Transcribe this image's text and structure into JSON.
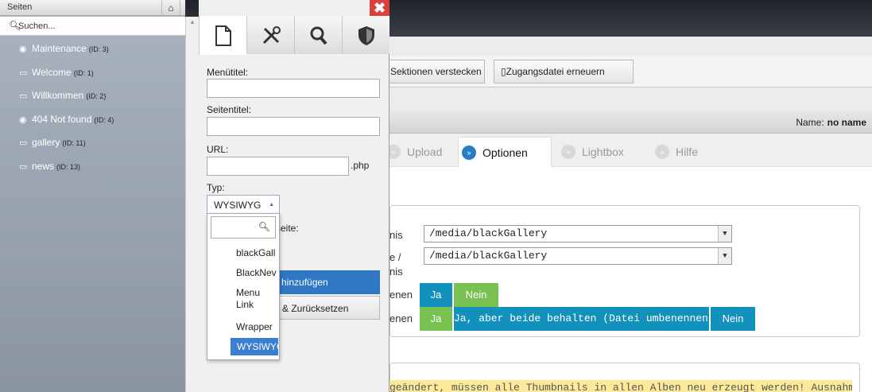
{
  "sidebar": {
    "title": "Seiten",
    "search_placeholder": "Suchen...",
    "pages": [
      {
        "name": "Maintenance",
        "id": "(ID: 3)",
        "icon": "eye-icon"
      },
      {
        "name": "Welcome",
        "id": "(ID: 1)",
        "icon": "monitor-icon"
      },
      {
        "name": "Willkommen",
        "id": "(ID: 2)",
        "icon": "monitor-icon"
      },
      {
        "name": "404 Not found",
        "id": "(ID: 4)",
        "icon": "eye-icon"
      },
      {
        "name": "gallery",
        "id": "(ID: 11)",
        "icon": "monitor-icon"
      },
      {
        "name": "news",
        "id": "(ID: 13)",
        "icon": "monitor-icon"
      }
    ]
  },
  "panel": {
    "tabs": [
      "page-icon",
      "tools-icon",
      "search-icon",
      "shield-icon"
    ],
    "menutitel_label": "Menütitel:",
    "seitentitel_label": "Seitentitel:",
    "url_label": "URL:",
    "url_suffix": ".php",
    "typ_label": "Typ:",
    "typ_value": "WYSIWYG",
    "startseite_label": "seite:",
    "add_button": "e hinzufügen",
    "reset_button": "o & Zurücksetzen",
    "options": [
      "blackGall",
      "BlackNev",
      "Menu Link",
      "Wrapper",
      "WYSIWYG"
    ]
  },
  "toolbar": {
    "hide_sections": "Sektionen verstecken",
    "renew_access": "Zugangsdatei erneuern"
  },
  "namebar": {
    "label": "Name:",
    "value": "no name"
  },
  "tabs": [
    {
      "label": "Upload",
      "active": false
    },
    {
      "label": "Optionen",
      "active": true
    },
    {
      "label": "Lightbox",
      "active": false
    },
    {
      "label": "Hilfe",
      "active": false
    }
  ],
  "options_form": {
    "row1_label": "nis",
    "row1_value": "/media/blackGallery",
    "row2_label_a": "e /",
    "row2_label_b": "nis",
    "row2_value": "/media/blackGallery",
    "row3_label": "enen",
    "row3_ja": "Ja",
    "row3_nein": "Nein",
    "row4_label": "enen",
    "row4_ja": "Ja",
    "row4_both": "Ja, aber beide behalten (Datei umbenennen)",
    "row4_nein": "Nein"
  },
  "notice": "geändert, müssen alle Thumbnails in allen Alben neu erzeugt werden! Ausnahme:",
  "colors": {
    "accent_blue": "#1391bd",
    "accent_green": "#78c152",
    "close_red": "#d9413c",
    "notice_yellow": "#fde99a"
  }
}
